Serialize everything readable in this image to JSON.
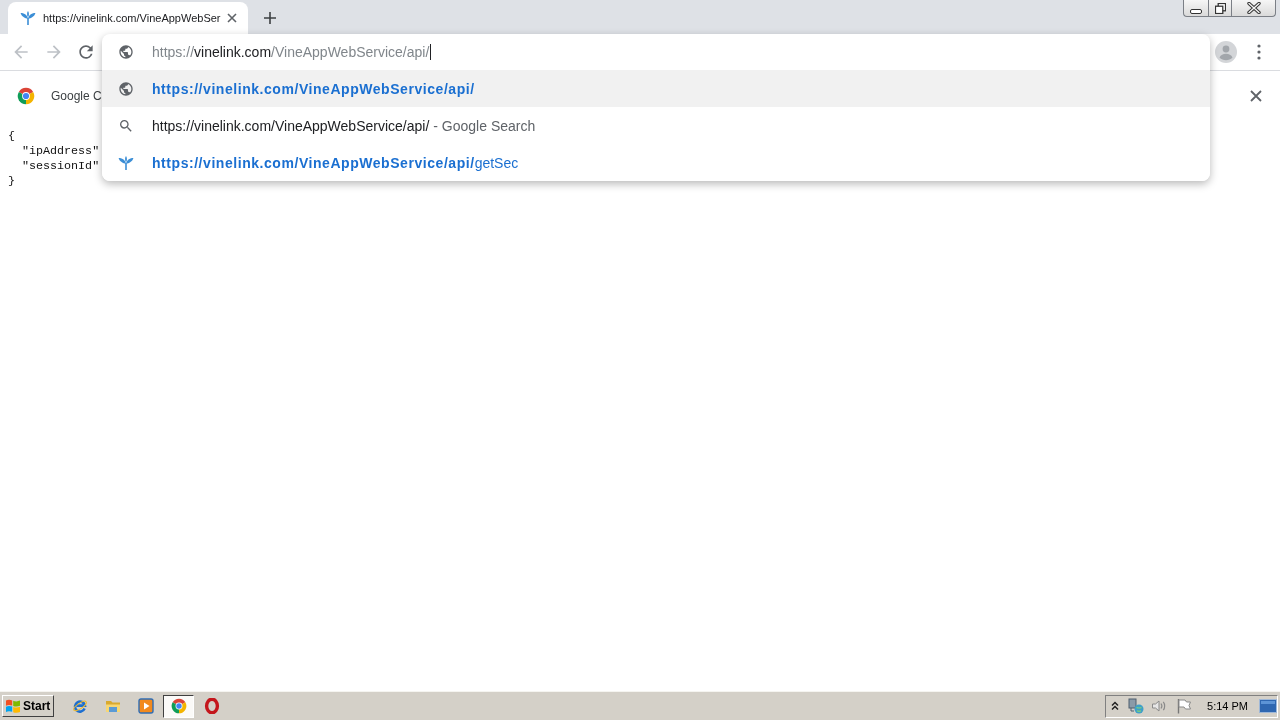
{
  "tabs": [
    {
      "title": "https://vinelink.com/VineAppWebSer",
      "selected": true
    }
  ],
  "window_controls": [
    {
      "kind": "minimize"
    },
    {
      "kind": "restore"
    },
    {
      "kind": "close"
    }
  ],
  "toolbar": {
    "nav_buttons": [
      {
        "kind": "back",
        "disabled": true
      },
      {
        "kind": "forward",
        "disabled": true
      },
      {
        "kind": "reload",
        "disabled": false
      }
    ]
  },
  "omnibox": {
    "scheme": "https://",
    "host": "vinelink.com",
    "path": "/VineAppWebService/api/",
    "suggestions": [
      {
        "kind": "url",
        "selected": true,
        "match": "https://vinelink.com/VineAppWebService/api/"
      },
      {
        "kind": "search",
        "selected": false,
        "text": "https://vinelink.com/VineAppWebService/api/",
        "description": "- Google Search"
      },
      {
        "kind": "history",
        "selected": false,
        "match": "https://vinelink.com/VineAppWebService/api/",
        "rest": "getSec"
      }
    ]
  },
  "info_bar": {
    "text": "Google C"
  },
  "page": {
    "open": "{",
    "keys": [
      "\"ipAddress\"",
      "\"sessionId\""
    ],
    "close": "}"
  },
  "taskbar": {
    "start": "Start",
    "apps": [
      {
        "kind": "e_globe",
        "selected": false
      },
      {
        "kind": "folder",
        "selected": false
      },
      {
        "kind": "player",
        "selected": false
      },
      {
        "kind": "tricolor",
        "selected": true
      },
      {
        "kind": "ring",
        "selected": false
      }
    ],
    "tray": [
      {
        "kind": "chevron"
      },
      {
        "kind": "network"
      },
      {
        "kind": "volume"
      },
      {
        "kind": "flag"
      }
    ],
    "clock": "5:14 PM"
  }
}
